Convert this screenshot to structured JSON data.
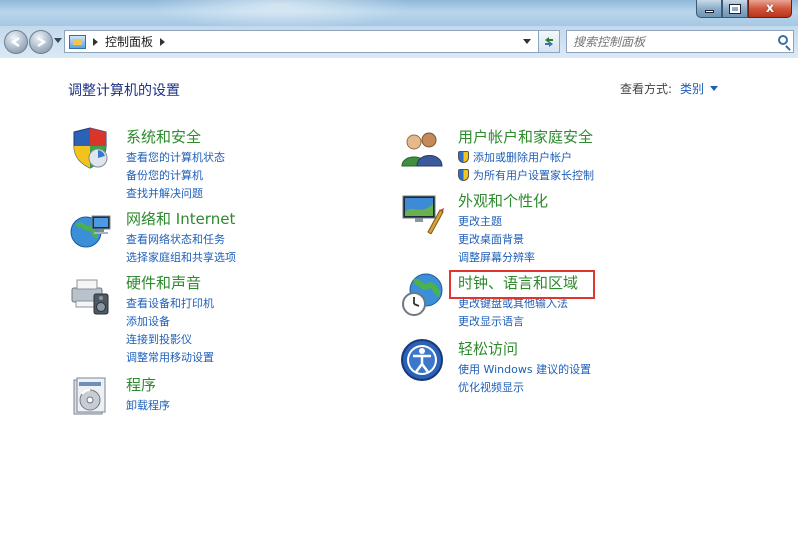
{
  "window": {
    "close_glyph": "x"
  },
  "toolbar": {
    "breadcrumb": [
      "控制面板"
    ],
    "search_placeholder": "搜索控制面板"
  },
  "content": {
    "page_title": "调整计算机的设置",
    "view_by_label": "查看方式:",
    "view_by_value": "类别"
  },
  "categories": [
    {
      "title": "系统和安全",
      "icon": "system-security-icon",
      "links": [
        "查看您的计算机状态",
        "备份您的计算机",
        "查找并解决问题"
      ]
    },
    {
      "title": "网络和 Internet",
      "icon": "network-icon",
      "links": [
        "查看网络状态和任务",
        "选择家庭组和共享选项"
      ]
    },
    {
      "title": "硬件和声音",
      "icon": "hardware-sound-icon",
      "links": [
        "查看设备和打印机",
        "添加设备",
        "连接到投影仪",
        "调整常用移动设置"
      ]
    },
    {
      "title": "程序",
      "icon": "programs-icon",
      "links": [
        "卸载程序"
      ]
    },
    {
      "title": "用户帐户和家庭安全",
      "icon": "user-accounts-icon",
      "links": [
        "添加或删除用户帐户",
        "为所有用户设置家长控制"
      ]
    },
    {
      "title": "外观和个性化",
      "icon": "appearance-icon",
      "links": [
        "更改主题",
        "更改桌面背景",
        "调整屏幕分辨率"
      ]
    },
    {
      "title": "时钟、语言和区域",
      "icon": "clock-language-icon",
      "links": [
        "更改键盘或其他输入法",
        "更改显示语言"
      ]
    },
    {
      "title": "轻松访问",
      "icon": "ease-of-access-icon",
      "links": [
        "使用 Windows 建议的设置",
        "优化视频显示"
      ]
    }
  ],
  "colors": {
    "category_title": "#2d8a2d",
    "link": "#1e5fb8",
    "highlight": "#e0362e"
  }
}
